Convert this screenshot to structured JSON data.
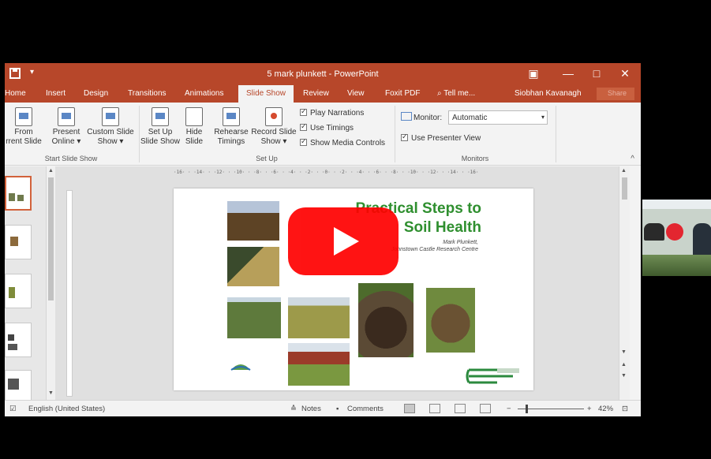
{
  "window": {
    "title": "5 mark plunkett - PowerPoint",
    "quick_access": "▾",
    "controls": {
      "ribbon_options": "▣",
      "minimize": "—",
      "maximize": "□",
      "close": "✕"
    }
  },
  "tabs": [
    {
      "label": "Home",
      "active": false
    },
    {
      "label": "Insert",
      "active": false
    },
    {
      "label": "Design",
      "active": false
    },
    {
      "label": "Transitions",
      "active": false
    },
    {
      "label": "Animations",
      "active": false
    },
    {
      "label": "Slide Show",
      "active": true
    },
    {
      "label": "Review",
      "active": false
    },
    {
      "label": "View",
      "active": false
    },
    {
      "label": "Foxit PDF",
      "active": false
    },
    {
      "label": "⌕ Tell me...",
      "active": false
    }
  ],
  "user": {
    "name": "Siobhan Kavanagh",
    "share_label": "Share"
  },
  "ribbon": {
    "start_group": {
      "label": "Start Slide Show",
      "from_current": "From\nrrent Slide",
      "present_online": "Present\nOnline ▾",
      "custom_show": "Custom Slide\nShow ▾"
    },
    "setup_group": {
      "label": "Set Up",
      "set_up": "Set Up\nSlide Show",
      "hide": "Hide\nSlide",
      "rehearse": "Rehearse\nTimings",
      "record": "Record Slide\nShow ▾",
      "play_narrations": "Play Narrations",
      "use_timings": "Use Timings",
      "show_media": "Show Media Controls"
    },
    "monitors_group": {
      "label": "Monitors",
      "monitor_label": "Monitor:",
      "monitor_value": "Automatic",
      "presenter_view": "Use Presenter View"
    }
  },
  "ruler": {
    "horizontal": "·16· · ·14· · ·12· · ·10· · ·8· · ·6· · ·4· · ·2· · ·0· · ·2· · ·4· · ·6· · ·8· · ·10· · ·12· · ·14· · ·16·"
  },
  "slide": {
    "title": "Practical Steps to Soil Health",
    "author": "Mark Plunkett,",
    "affiliation": "Johnstown Castle Research Centre"
  },
  "status": {
    "language": "English (United States)",
    "notes": "Notes",
    "comments": "Comments",
    "zoom": "42%"
  }
}
